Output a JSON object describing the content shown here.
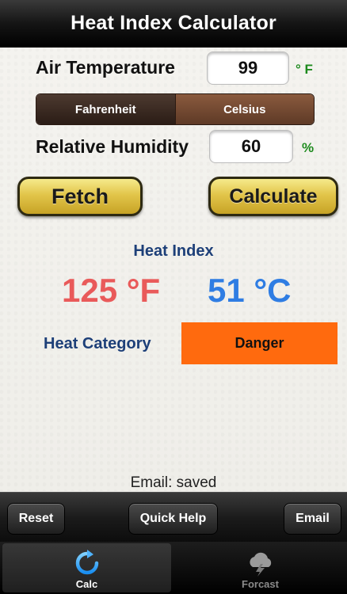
{
  "header": {
    "title": "Heat Index Calculator"
  },
  "air_temperature": {
    "label": "Air Temperature",
    "value": "99",
    "unit": "° F"
  },
  "unit_toggle": {
    "options": [
      "Fahrenheit",
      "Celsius"
    ],
    "selected": "Fahrenheit"
  },
  "humidity": {
    "label": "Relative Humidity",
    "value": "60",
    "unit": "%"
  },
  "actions": {
    "fetch_label": "Fetch",
    "calculate_label": "Calculate"
  },
  "result": {
    "title": "Heat Index",
    "fahrenheit": "125 °F",
    "celsius": "51 °C",
    "category_label": "Heat Category",
    "category_value": "Danger",
    "category_color": "#ff6a0e"
  },
  "status": {
    "email": "Email: saved"
  },
  "toolbar": {
    "reset_label": "Reset",
    "help_label": "Quick Help",
    "email_label": "Email"
  },
  "tabs": [
    {
      "label": "Calc",
      "icon": "refresh-icon",
      "active": true
    },
    {
      "label": "Forcast",
      "icon": "storm-cloud-icon",
      "active": false
    }
  ],
  "colors": {
    "accent_gold": "#e2c54a",
    "heat_f": "#e95a5a",
    "heat_c": "#2f7de3",
    "unit_green": "#1d8a1d"
  }
}
